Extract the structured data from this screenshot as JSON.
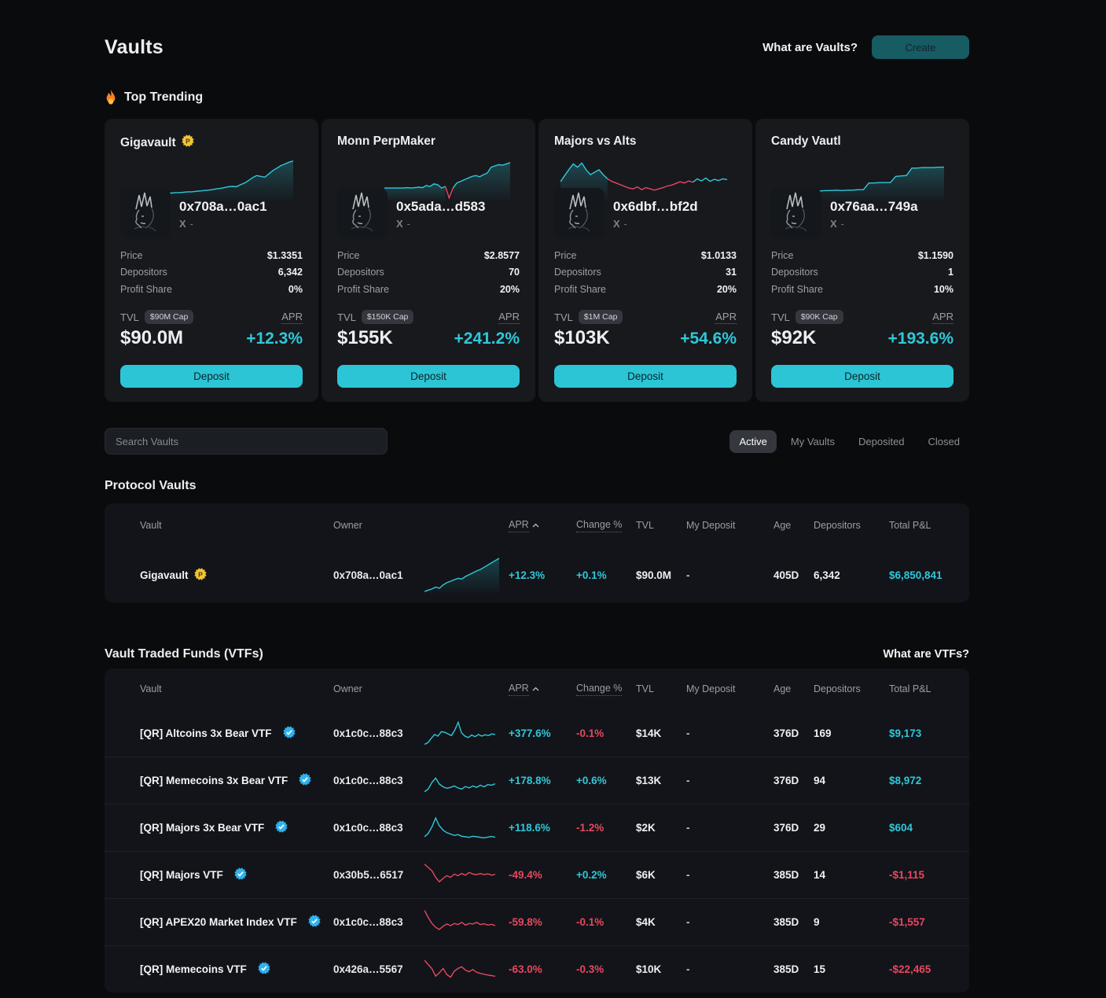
{
  "colors": {
    "accent": "#2fc8d9",
    "negative": "#e8475f",
    "gold": "#f3c436",
    "verified": "#2fb3f0"
  },
  "header": {
    "title": "Vaults",
    "help_link": "What are Vaults?",
    "create_label": "Create"
  },
  "trending": {
    "heading": "Top Trending",
    "labels": {
      "price": "Price",
      "depositors": "Depositors",
      "profit_share": "Profit Share",
      "tvl": "TVL",
      "apr": "APR",
      "deposit": "Deposit"
    },
    "cards": [
      {
        "name": "Gigavault",
        "gold_badge": true,
        "address": "0x708a…0ac1",
        "x_handle": "-",
        "price": "$1.3351",
        "depositors": "6,342",
        "profit_share": "0%",
        "cap_badge": "$90M Cap",
        "tvl": "$90.0M",
        "apr": "+12.3%",
        "spark_inset": true,
        "spark": [
          {
            "c": "pos",
            "f": true,
            "pts": [
              18,
              18,
              19,
              19,
              20,
              21,
              21,
              22,
              23,
              24,
              25,
              26,
              28,
              29,
              31,
              33,
              34,
              33,
              38,
              42,
              48,
              55,
              60,
              58,
              56,
              64,
              72,
              78,
              84,
              88,
              92,
              95
            ]
          }
        ]
      },
      {
        "name": "Monn PerpMaker",
        "gold_badge": false,
        "address": "0x5ada…d583",
        "x_handle": "-",
        "price": "$2.8577",
        "depositors": "70",
        "profit_share": "20%",
        "cap_badge": "$150K Cap",
        "tvl": "$155K",
        "apr": "+241.2%",
        "spark_inset": true,
        "spark": [
          {
            "c": "pos",
            "f": true,
            "pts": [
              30,
              30,
              30,
              30,
              30,
              30,
              31,
              30,
              31,
              32,
              31,
              36,
              34,
              40,
              38,
              30,
              34
            ]
          },
          {
            "c": "neg",
            "f": false,
            "pts": [
              34,
              6,
              30
            ]
          },
          {
            "c": "pos",
            "f": true,
            "pts": [
              30,
              42,
              46,
              50,
              54,
              58,
              60,
              57,
              62,
              66,
              80,
              83,
              86,
              85,
              88,
              91
            ]
          }
        ]
      },
      {
        "name": "Majors vs Alts",
        "gold_badge": false,
        "address": "0x6dbf…bf2d",
        "x_handle": "-",
        "price": "$1.0133",
        "depositors": "31",
        "profit_share": "20%",
        "cap_badge": "$1M Cap",
        "tvl": "$103K",
        "apr": "+54.6%",
        "spark_inset": false,
        "spark": [
          {
            "c": "pos",
            "f": true,
            "pts": [
              45,
              60,
              75,
              88,
              80,
              90,
              74,
              62,
              68,
              74,
              62,
              52
            ]
          },
          {
            "c": "neg",
            "f": false,
            "pts": [
              52,
              46,
              42,
              38,
              34,
              30,
              28,
              33,
              26,
              31,
              28,
              25,
              28,
              31,
              35,
              37,
              41,
              45,
              42,
              47,
              44
            ]
          },
          {
            "c": "pos",
            "f": false,
            "pts": [
              44,
              52,
              47,
              54,
              46,
              51,
              48,
              52,
              50
            ]
          }
        ]
      },
      {
        "name": "Candy Vautl",
        "gold_badge": false,
        "address": "0x76aa…749a",
        "x_handle": "-",
        "price": "$1.1590",
        "depositors": "1",
        "profit_share": "10%",
        "cap_badge": "$90K Cap",
        "tvl": "$92K",
        "apr": "+193.6%",
        "spark_inset": false,
        "spark": [
          {
            "c": "pos",
            "f": true,
            "pts": [
              22,
              22,
              22,
              23,
              22,
              23,
              23,
              24,
              23,
              24,
              24,
              25,
              24,
              25,
              25,
              26,
              26,
              42,
              42,
              43,
              43,
              43,
              58,
              59,
              60,
              78,
              78,
              79,
              79,
              79,
              80,
              80
            ]
          }
        ]
      }
    ]
  },
  "filters": {
    "search_placeholder": "Search Vaults",
    "tabs": [
      "Active",
      "My Vaults",
      "Deposited",
      "Closed"
    ],
    "active_tab": "Active"
  },
  "protocol": {
    "heading": "Protocol Vaults",
    "columns": [
      "Vault",
      "Owner",
      "",
      "APR",
      "Change %",
      "TVL",
      "My Deposit",
      "Age",
      "Depositors",
      "Total P&L"
    ],
    "rows": [
      {
        "name": "Gigavault",
        "gold_badge": true,
        "verified": false,
        "owner": "0x708a…0ac1",
        "apr": "+12.3%",
        "apr_tone": "pos",
        "change": "+0.1%",
        "change_tone": "pos",
        "tvl": "$90.0M",
        "my_deposit": "-",
        "age": "405D",
        "depositors": "6,342",
        "pnl": "$6,850,841",
        "pnl_tone": "pos",
        "spark": [
          {
            "c": "pos",
            "f": true,
            "pts": [
              6,
              10,
              13,
              18,
              15,
              24,
              30,
              34,
              38,
              42,
              40,
              47,
              52,
              57,
              62,
              66,
              72,
              78,
              84,
              90,
              96
            ]
          }
        ]
      }
    ]
  },
  "vtf": {
    "heading": "Vault Traded Funds (VTFs)",
    "help_link": "What are VTFs?",
    "columns": [
      "Vault",
      "Owner",
      "",
      "APR",
      "Change %",
      "TVL",
      "My Deposit",
      "Age",
      "Depositors",
      "Total P&L"
    ],
    "rows": [
      {
        "name": "[QR] Altcoins 3x Bear VTF",
        "gold_badge": false,
        "verified": true,
        "owner": "0x1c0c…88c3",
        "apr": "+377.6%",
        "apr_tone": "pos",
        "change": "-0.1%",
        "change_tone": "neg",
        "tvl": "$14K",
        "my_deposit": "-",
        "age": "376D",
        "depositors": "169",
        "pnl": "$9,173",
        "pnl_tone": "pos",
        "spark": [
          {
            "c": "pos",
            "f": false,
            "pts": [
              10,
              16,
              32,
              46,
              40,
              56,
              54,
              48,
              42,
              62,
              90,
              52,
              40,
              35,
              44,
              38,
              46,
              40,
              45,
              42,
              48,
              46
            ]
          }
        ]
      },
      {
        "name": "[QR] Memecoins 3x Bear VTF",
        "gold_badge": false,
        "verified": true,
        "owner": "0x1c0c…88c3",
        "apr": "+178.8%",
        "apr_tone": "pos",
        "change": "+0.6%",
        "change_tone": "pos",
        "tvl": "$13K",
        "my_deposit": "-",
        "age": "376D",
        "depositors": "94",
        "pnl": "$8,972",
        "pnl_tone": "pos",
        "spark": [
          {
            "c": "pos",
            "f": false,
            "pts": [
              12,
              22,
              46,
              62,
              40,
              30,
              25,
              28,
              33,
              26,
              22,
              31,
              26,
              33,
              28,
              36,
              30,
              38,
              36,
              41
            ]
          }
        ]
      },
      {
        "name": "[QR] Majors 3x Bear VTF",
        "gold_badge": false,
        "verified": true,
        "owner": "0x1c0c…88c3",
        "apr": "+118.6%",
        "apr_tone": "pos",
        "change": "-1.2%",
        "change_tone": "neg",
        "tvl": "$2K",
        "my_deposit": "-",
        "age": "376D",
        "depositors": "29",
        "pnl": "$604",
        "pnl_tone": "pos",
        "spark": [
          {
            "c": "pos",
            "f": false,
            "pts": [
              20,
              32,
              56,
              88,
              60,
              44,
              35,
              30,
              25,
              28,
              22,
              20,
              18,
              22,
              20,
              18,
              16,
              19,
              21,
              18
            ]
          }
        ]
      },
      {
        "name": "[QR] Majors VTF",
        "gold_badge": false,
        "verified": true,
        "owner": "0x30b5…6517",
        "apr": "-49.4%",
        "apr_tone": "neg",
        "change": "+0.2%",
        "change_tone": "pos",
        "tvl": "$6K",
        "my_deposit": "-",
        "age": "385D",
        "depositors": "14",
        "pnl": "-$1,115",
        "pnl_tone": "neg",
        "spark": [
          {
            "c": "neg",
            "f": false,
            "pts": [
              92,
              80,
              68,
              44,
              28,
              40,
              50,
              44,
              56,
              50,
              58,
              52,
              62,
              56,
              54,
              58,
              54,
              57,
              52,
              55
            ]
          }
        ]
      },
      {
        "name": "[QR] APEX20 Market Index VTF",
        "gold_badge": false,
        "verified": true,
        "owner": "0x1c0c…88c3",
        "apr": "-59.8%",
        "apr_tone": "neg",
        "change": "-0.1%",
        "change_tone": "neg",
        "tvl": "$4K",
        "my_deposit": "-",
        "age": "385D",
        "depositors": "9",
        "pnl": "-$1,557",
        "pnl_tone": "neg",
        "spark": [
          {
            "c": "neg",
            "f": false,
            "pts": [
              96,
              70,
              48,
              34,
              26,
              38,
              46,
              40,
              48,
              44,
              52,
              42,
              48,
              46,
              52,
              44,
              47,
              42,
              45,
              40
            ]
          }
        ]
      },
      {
        "name": "[QR] Memecoins VTF",
        "gold_badge": false,
        "verified": true,
        "owner": "0x426a…5567",
        "apr": "-63.0%",
        "apr_tone": "neg",
        "change": "-0.3%",
        "change_tone": "neg",
        "tvl": "$10K",
        "my_deposit": "-",
        "age": "385D",
        "depositors": "15",
        "pnl": "-$22,465",
        "pnl_tone": "neg",
        "spark": [
          {
            "c": "neg",
            "f": false,
            "pts": [
              86,
              70,
              55,
              28,
              40,
              56,
              34,
              24,
              46,
              56,
              62,
              50,
              44,
              52,
              42,
              38,
              35,
              32,
              30,
              27
            ]
          }
        ]
      }
    ]
  }
}
